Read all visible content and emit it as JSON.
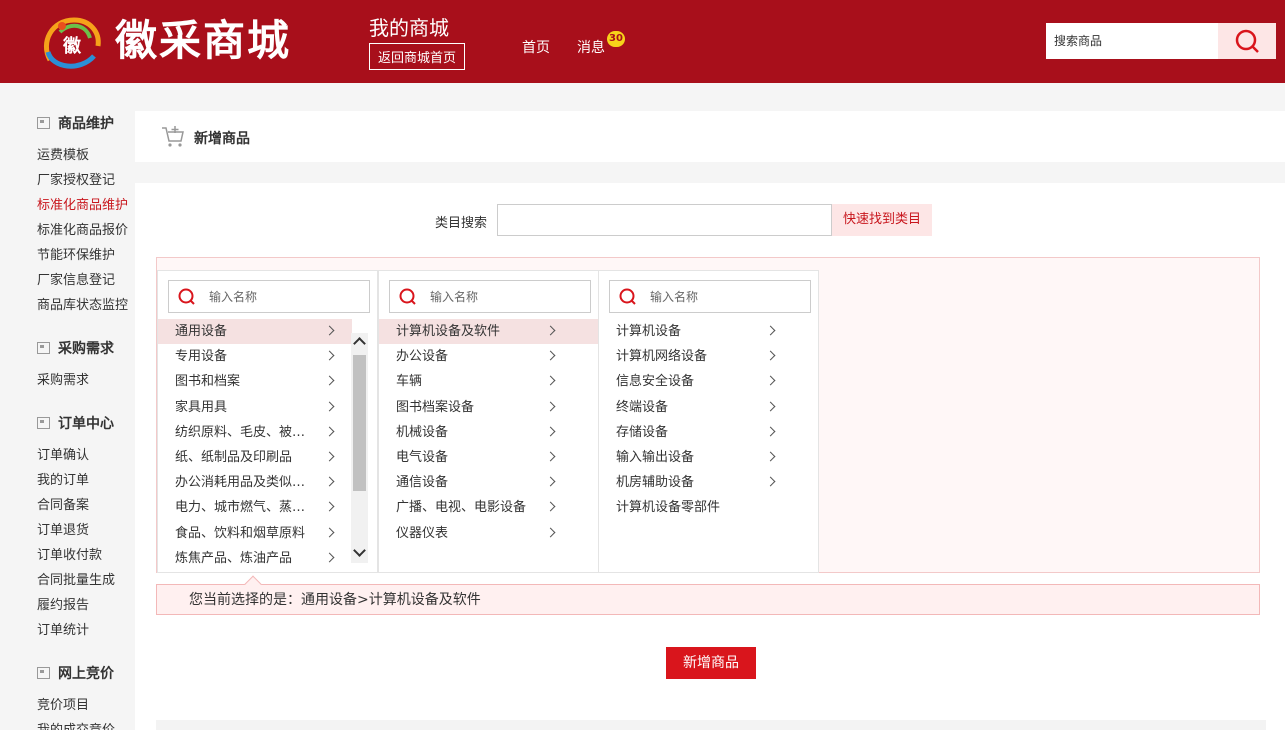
{
  "header": {
    "brand": "徽采商城",
    "logo_text": "徽",
    "my_mall": "我的商城",
    "back_link": "返回商城首页",
    "nav_home": "首页",
    "nav_messages": "消息",
    "message_count": "30",
    "search_placeholder": "搜索商品"
  },
  "sidebar": {
    "groups": [
      {
        "title": "商品维护",
        "items": [
          "运费模板",
          "厂家授权登记",
          "标准化商品维护",
          "标准化商品报价",
          "节能环保维护",
          "厂家信息登记",
          "商品库状态监控"
        ]
      },
      {
        "title": "采购需求",
        "items": [
          "采购需求"
        ]
      },
      {
        "title": "订单中心",
        "items": [
          "订单确认",
          "我的订单",
          "合同备案",
          "订单退货",
          "订单收付款",
          "合同批量生成",
          "履约报告",
          "订单统计"
        ]
      },
      {
        "title": "网上竞价",
        "items": [
          "竞价项目",
          "我的成交竞价"
        ]
      }
    ],
    "active_item": "标准化商品维护"
  },
  "page": {
    "title": "新增商品",
    "category_search_label": "类目搜索",
    "category_search_button": "快速找到类目",
    "column_search_placeholder": "输入名称",
    "selected_prefix": "您当前选择的是：",
    "selected_path": "通用设备>计算机设备及软件",
    "add_button": "新增商品"
  },
  "columns": [
    {
      "items": [
        "通用设备",
        "专用设备",
        "图书和档案",
        "家具用具",
        "纺织原料、毛皮、被服装具",
        "纸、纸制品及印刷品",
        "办公消耗用品及类似物品",
        "电力、城市燃气、蒸汽和热水",
        "食品、饮料和烟草原料",
        "炼焦产品、炼油产品"
      ],
      "selected": 0,
      "chevrons": [
        true,
        true,
        true,
        true,
        true,
        true,
        true,
        true,
        true,
        true
      ]
    },
    {
      "items": [
        "计算机设备及软件",
        "办公设备",
        "车辆",
        "图书档案设备",
        "机械设备",
        "电气设备",
        "通信设备",
        "广播、电视、电影设备",
        "仪器仪表"
      ],
      "selected": 0,
      "chevrons": [
        true,
        true,
        true,
        true,
        true,
        true,
        true,
        true,
        true
      ]
    },
    {
      "items": [
        "计算机设备",
        "计算机网络设备",
        "信息安全设备",
        "终端设备",
        "存储设备",
        "输入输出设备",
        "机房辅助设备",
        "计算机设备零部件"
      ],
      "selected": -1,
      "chevrons": [
        true,
        true,
        true,
        true,
        true,
        true,
        true,
        false
      ]
    }
  ],
  "colors": {
    "header_red": "#a80f1b",
    "accent_red": "#d9151c",
    "active_link": "#c8161d"
  }
}
